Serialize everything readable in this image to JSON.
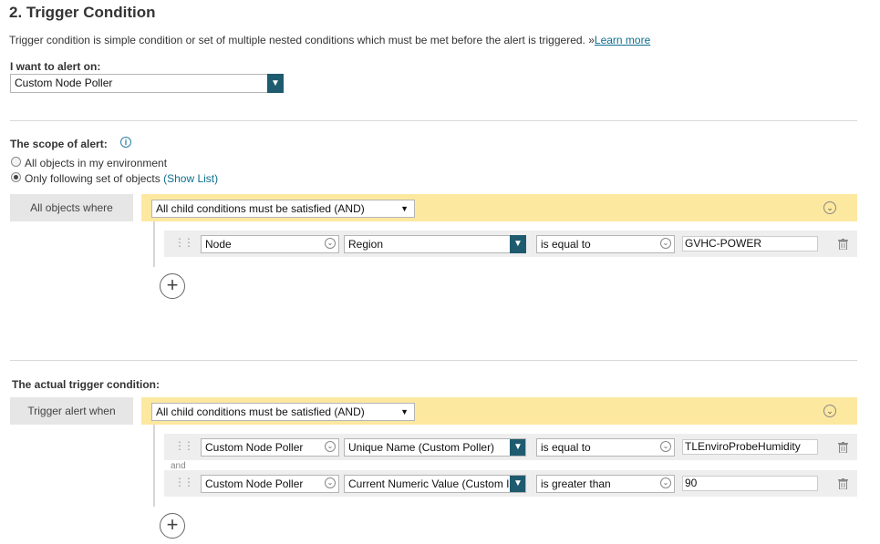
{
  "section": {
    "title": "2. Trigger Condition",
    "description": "Trigger condition is simple condition or set of multiple nested conditions which must be met before the alert is triggered. »",
    "learn_more": "Learn more"
  },
  "alert_on": {
    "label": "I want to alert on:",
    "value": "Custom Node Poller"
  },
  "scope": {
    "label": "The scope of alert:",
    "option_all": "All objects in my environment",
    "option_following": "Only following set of objects",
    "show_list": "(Show List)",
    "selected": "option_following",
    "group_label": "All objects where",
    "group_operator": "All child conditions must be satisfied (AND)",
    "conditions": [
      {
        "object": "Node",
        "field": "Region",
        "operator": "is equal to",
        "value": "GVHC-POWER"
      }
    ]
  },
  "trigger": {
    "label": "The actual trigger condition:",
    "group_label": "Trigger alert when",
    "group_operator": "All child conditions must be satisfied (AND)",
    "join_word": "and",
    "conditions": [
      {
        "object": "Custom Node Poller",
        "field": "Unique Name (Custom Poller)",
        "operator": "is equal to",
        "value": "TLEnviroProbeHumidity"
      },
      {
        "object": "Custom Node Poller",
        "field": "Current Numeric Value (Custom I",
        "operator": "is greater than",
        "value": "90"
      }
    ]
  },
  "colors": {
    "accent": "#1f5b6f",
    "group_bar": "#fde8a0",
    "link": "#0d6f8f"
  }
}
